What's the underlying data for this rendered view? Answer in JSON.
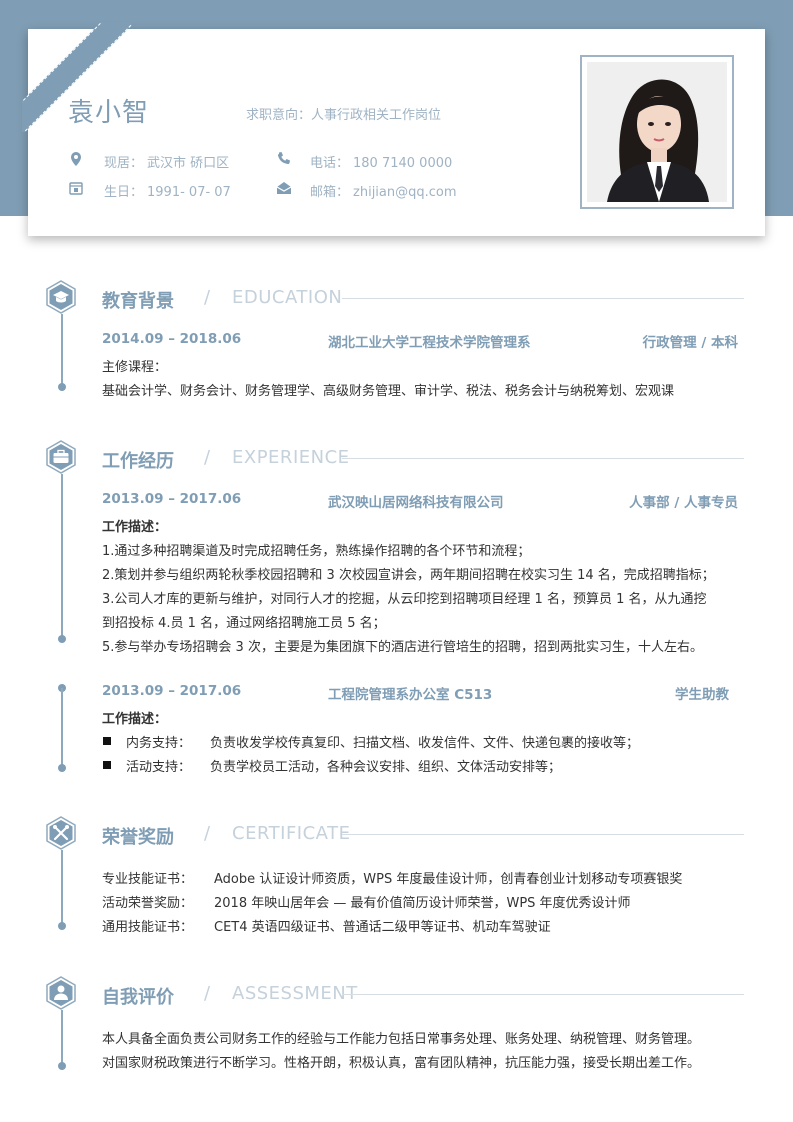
{
  "header": {
    "name": "袁小智",
    "intent": "求职意向：人事行政相关工作岗位",
    "location_label": "现居：",
    "location": "武汉市 硚口区",
    "phone_label": "电话：",
    "phone": "180 7140 0000",
    "birthday_label": "生日：",
    "birthday": "1991- 07- 07",
    "email_label": "邮箱：",
    "email": "zhijian@qq.com"
  },
  "education": {
    "title": "教育背景",
    "title_en": "EDUCATION",
    "date": "2014.09 – 2018.06",
    "school": "湖北工业大学工程技术学院管理系",
    "major": "行政管理 / 本科",
    "courses_label": "主修课程：",
    "courses": "基础会计学、财务会计、财务管理学、高级财务管理、审计学、税法、税务会计与纳税筹划、宏观课"
  },
  "experience": {
    "title": "工作经历",
    "title_en": "EXPERIENCE",
    "jobs": [
      {
        "date": "2013.09 – 2017.06",
        "company": "武汉映山居网络科技有限公司",
        "role": "人事部 / 人事专员",
        "desc_label": "工作描述：",
        "lines": [
          "1.通过多种招聘渠道及时完成招聘任务，熟练操作招聘的各个环节和流程；",
          "2.策划并参与组织两轮秋季校园招聘和 3 次校园宣讲会，两年期间招聘在校实习生 14 名，完成招聘指标；",
          "3.公司人才库的更新与维护，对同行人才的挖掘，从云印挖到招聘项目经理 1 名，预算员 1 名，从九通挖",
          "到招投标 4.员 1 名，通过网络招聘施工员 5 名；",
          "5.参与举办专场招聘会 3 次，主要是为集团旗下的酒店进行管培生的招聘，招到两批实习生，十人左右。"
        ]
      },
      {
        "date": "2013.09 – 2017.06",
        "company": "工程院管理系办公室 C513",
        "role": "学生助教",
        "desc_label": "工作描述：",
        "items": [
          {
            "label": "内务支持：",
            "text": "负责收发学校传真复印、扫描文档、收发信件、文件、快递包裹的接收等；"
          },
          {
            "label": "活动支持：",
            "text": "负责学校员工活动，各种会议安排、组织、文体活动安排等；"
          }
        ]
      }
    ]
  },
  "certificate": {
    "title": "荣誉奖励",
    "title_en": "CERTIFICATE",
    "rows": [
      {
        "label": "专业技能证书：",
        "text": "Adobe 认证设计师资质，WPS 年度最佳设计师，创青春创业计划移动专项赛银奖"
      },
      {
        "label": "活动荣誉奖励：",
        "text": "2018 年映山居年会 — 最有价值简历设计师荣誉，WPS 年度优秀设计师"
      },
      {
        "label": "通用技能证书：",
        "text": "CET4  英语四级证书、普通话二级甲等证书、机动车驾驶证"
      }
    ]
  },
  "assessment": {
    "title": "自我评价",
    "title_en": "ASSESSMENT",
    "lines": [
      "本人具备全面负责公司财务工作的经验与工作能力包括日常事务处理、账务处理、纳税管理、财务管理。",
      "对国家财税政策进行不断学习。性格开朗，积极认真，富有团队精神，抗压能力强，接受长期出差工作。"
    ]
  },
  "colors": {
    "accent": "#7f9db4",
    "muted": "#c5d1db",
    "text": "#333333"
  }
}
